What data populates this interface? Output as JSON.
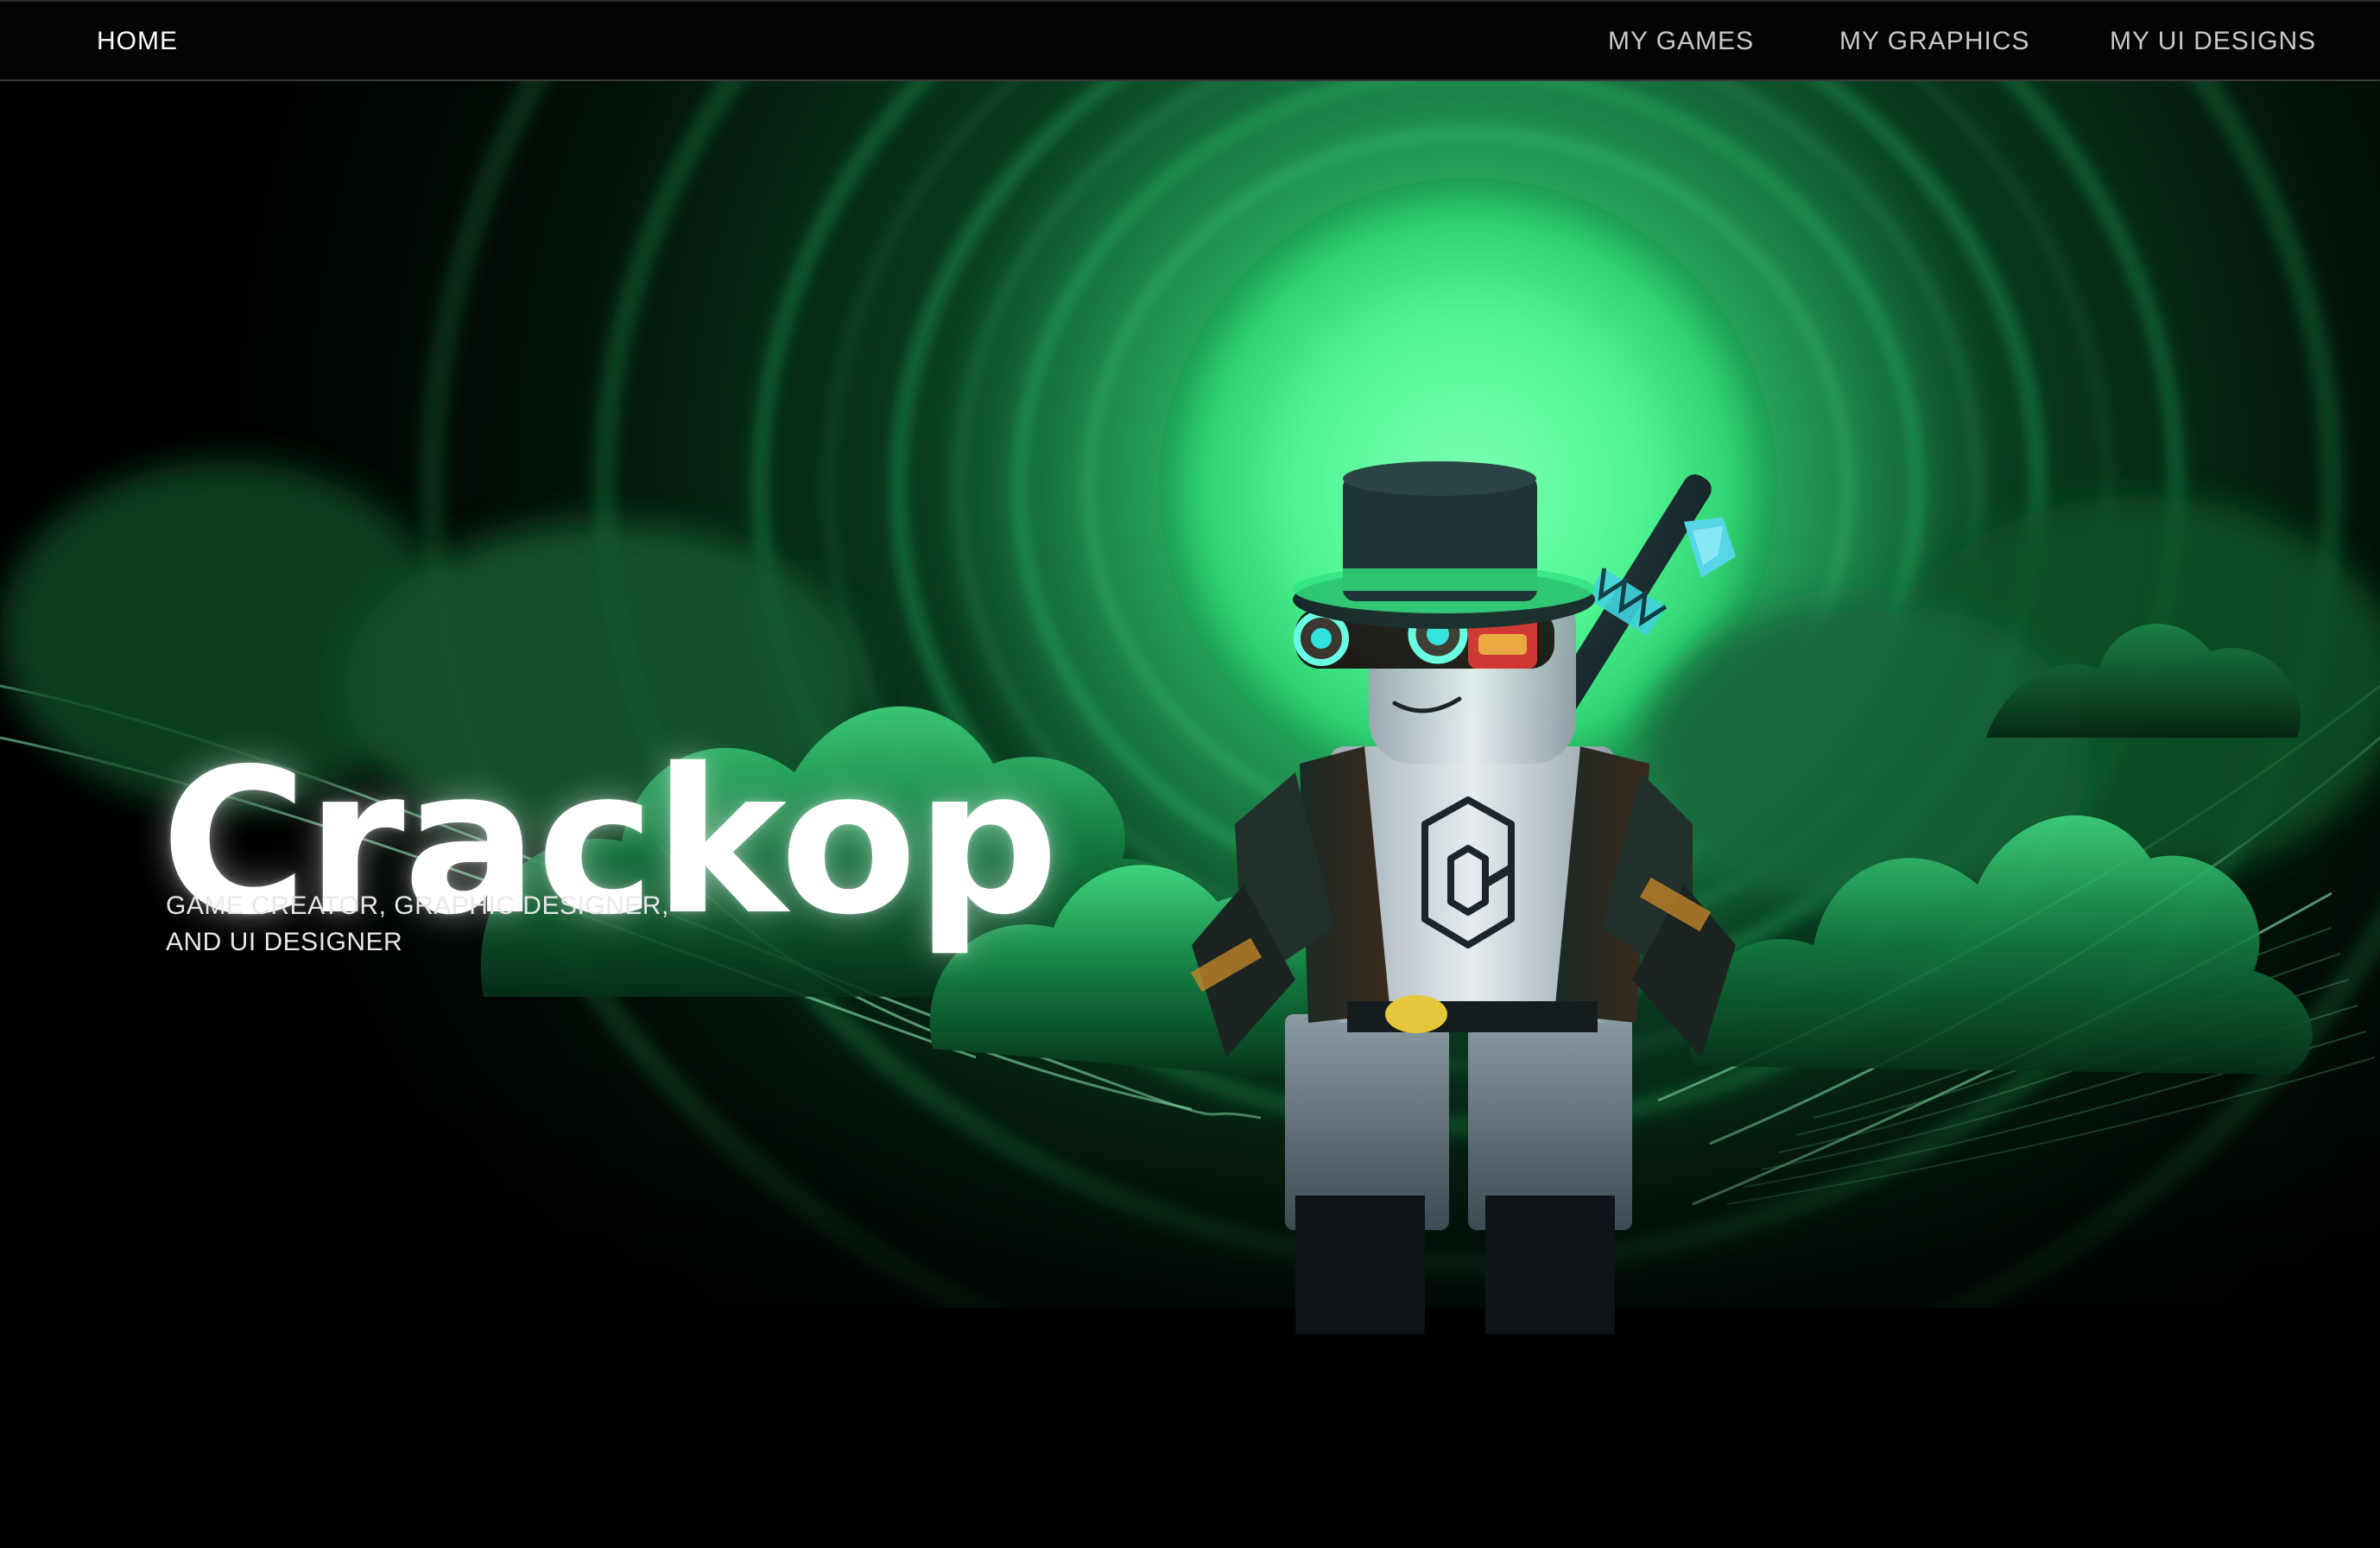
{
  "nav": {
    "home": "HOME",
    "games": "MY GAMES",
    "graphics": "MY GRAPHICS",
    "ui_designs": "MY UI DESIGNS"
  },
  "hero": {
    "title": "Crackop",
    "subtitle_line1": "GAME CREATOR, GRAPHIC DESIGNER,",
    "subtitle_line2": "AND UI DESIGNER",
    "character_shirt_letter": "C"
  },
  "colors": {
    "background": "#000000",
    "accent_green": "#4cf590",
    "deep_green": "#0d4a2a",
    "text": "#ffffff"
  }
}
